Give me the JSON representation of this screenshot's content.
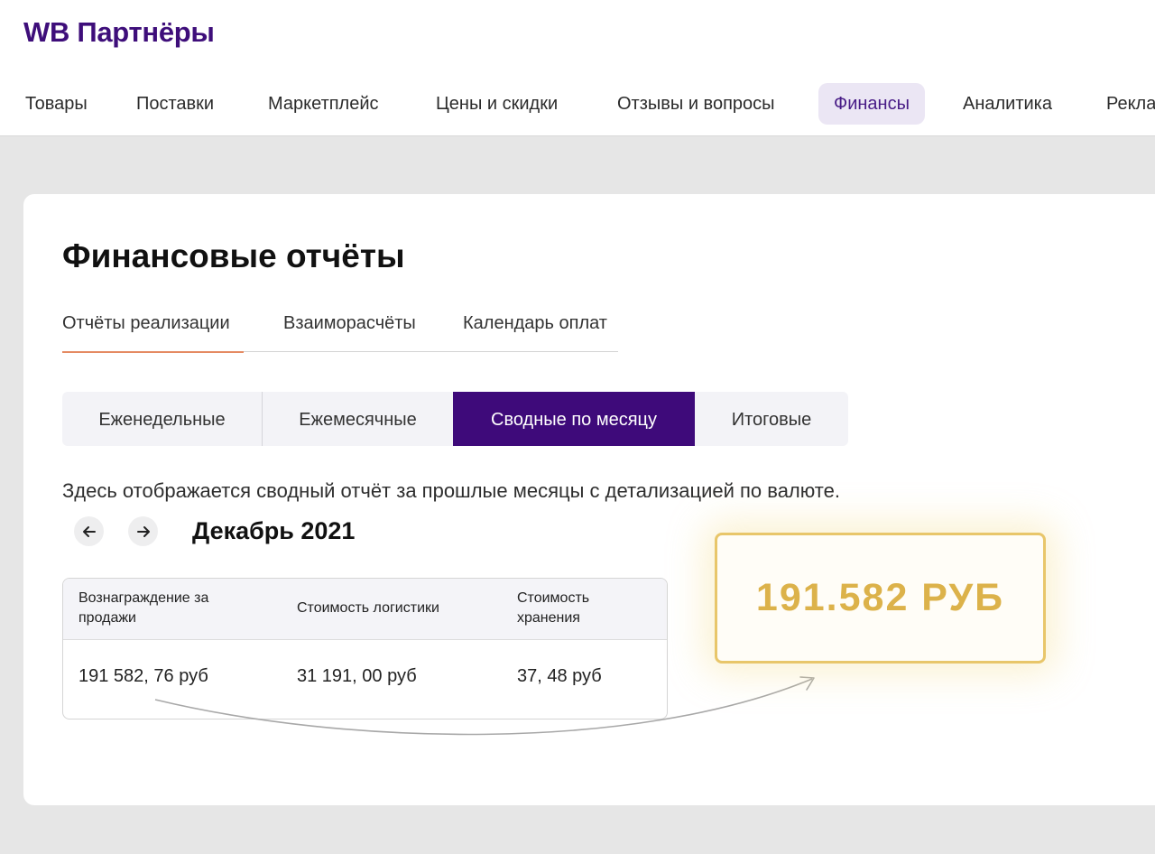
{
  "brand": "WB Партнёры",
  "nav": [
    {
      "label": "Товары",
      "active": false
    },
    {
      "label": "Поставки",
      "active": false
    },
    {
      "label": "Маркетплейс",
      "active": false
    },
    {
      "label": "Цены и скидки",
      "active": false
    },
    {
      "label": "Отзывы и вопросы",
      "active": false
    },
    {
      "label": "Финансы",
      "active": true
    },
    {
      "label": "Аналитика",
      "active": false
    },
    {
      "label": "Рекла",
      "active": false
    }
  ],
  "page_title": "Финансовые отчёты",
  "tabs": [
    {
      "label": "Отчёты реализации",
      "active": true
    },
    {
      "label": "Взаиморасчёты",
      "active": false
    },
    {
      "label": "Календарь оплат",
      "active": false
    }
  ],
  "segments": [
    {
      "label": "Еженедельные",
      "active": false
    },
    {
      "label": "Ежемесячные",
      "active": false
    },
    {
      "label": "Сводные по месяцу",
      "active": true
    },
    {
      "label": "Итоговые",
      "active": false
    }
  ],
  "description": "Здесь отображается сводный отчёт за прошлые месяцы с детализацией по валюте.",
  "period": {
    "prev_icon": "arrow-left-icon",
    "next_icon": "arrow-right-icon",
    "month": "Декабрь 2021"
  },
  "table": {
    "headers": [
      "Вознаграждение за продажи",
      "Стоимость логистики",
      "Стоимость хранения"
    ],
    "row": [
      "191 582, 76 руб",
      "31 191, 00 руб",
      "37, 48 руб"
    ]
  },
  "highlight": {
    "text": "191.582 РУБ",
    "color": "#dcb24a"
  },
  "colors": {
    "brand": "#3e0e7a",
    "active_segment": "#3e0a7a",
    "active_tab_underline": "#e58a62"
  }
}
